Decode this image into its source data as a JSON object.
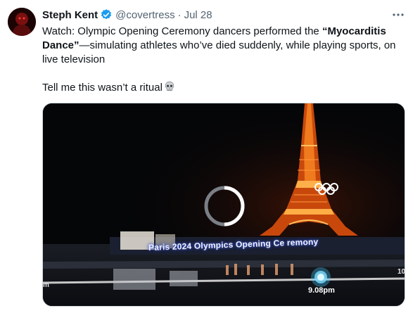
{
  "author": {
    "name": "Steph Kent",
    "handle": "@covertress",
    "separator": "·",
    "date": "Jul 28"
  },
  "tweet": {
    "line1_prefix": "Watch: Olympic Opening Ceremony dancers performed the ",
    "line1_bold": "“Myocarditis Dance”",
    "line1_suffix": "—simulating athletes who’ve died suddenly, while playing sports, on live television",
    "line2": "Tell me this wasn’t a ritual"
  },
  "media": {
    "caption": "Paris 2024 Olympics Opening Ce remony",
    "time_label": "9.08pm",
    "edge_left": "m",
    "edge_right": "10",
    "status": "loading"
  },
  "icons": {
    "verified": "verified-badge-icon",
    "more": "more-options-icon",
    "skull": "skull-emoji-icon",
    "spinner": "loading-spinner-icon"
  },
  "colors": {
    "verified": "#1d9bf0",
    "text_secondary": "#536471",
    "text_primary": "#0f1419"
  }
}
